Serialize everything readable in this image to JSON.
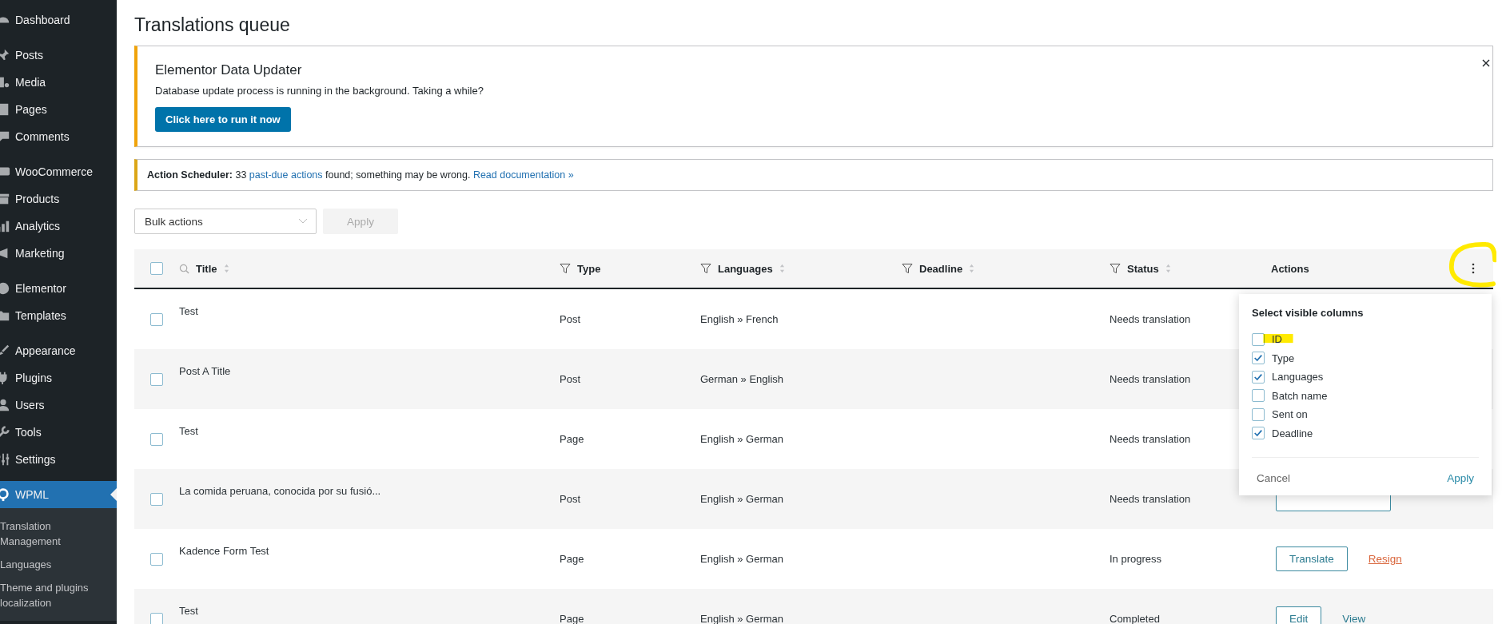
{
  "sidebar": {
    "groups": [
      [
        {
          "label": "Dashboard",
          "selected": false
        }
      ],
      [
        {
          "label": "Posts",
          "selected": false
        },
        {
          "label": "Media",
          "selected": false
        },
        {
          "label": "Pages",
          "selected": false
        },
        {
          "label": "Comments",
          "selected": false
        }
      ],
      [
        {
          "label": "WooCommerce",
          "selected": false
        },
        {
          "label": "Products",
          "selected": false
        },
        {
          "label": "Analytics",
          "selected": false
        },
        {
          "label": "Marketing",
          "selected": false
        }
      ],
      [
        {
          "label": "Elementor",
          "selected": false
        },
        {
          "label": "Templates",
          "selected": false
        }
      ],
      [
        {
          "label": "Appearance",
          "selected": false
        },
        {
          "label": "Plugins",
          "selected": false
        },
        {
          "label": "Users",
          "selected": false
        },
        {
          "label": "Tools",
          "selected": false
        },
        {
          "label": "Settings",
          "selected": false
        }
      ],
      [
        {
          "label": "WPML",
          "selected": true
        }
      ]
    ],
    "submenu": [
      "Translation Management",
      "Languages",
      "Theme and plugins localization"
    ]
  },
  "page_title": "Translations queue",
  "notice": {
    "title": "Elementor Data Updater",
    "message": "Database update process is running in the background. Taking a while?",
    "button": "Click here to run it now"
  },
  "scheduler": {
    "label": "Action Scheduler:",
    "count": "33",
    "link": "past-due actions",
    "text": "found; something may be wrong.",
    "doc_link": "Read documentation »"
  },
  "bulk": {
    "select": "Bulk actions",
    "apply": "Apply",
    "apply_disabled": true
  },
  "table": {
    "select_all_checked": false,
    "columns": [
      {
        "label": "Title",
        "search": true,
        "filter": false,
        "sortable": true
      },
      {
        "label": "Type",
        "search": false,
        "filter": true,
        "sortable": false
      },
      {
        "label": "Languages",
        "search": false,
        "filter": true,
        "sortable": true
      },
      {
        "label": "Deadline",
        "search": false,
        "filter": true,
        "sortable": true
      },
      {
        "label": "Status",
        "search": false,
        "filter": true,
        "sortable": true
      },
      {
        "label": "Actions",
        "search": false,
        "filter": false,
        "sortable": false
      }
    ],
    "rows": [
      {
        "checked": false,
        "title": "Test",
        "type": "Post",
        "languages": "English » French",
        "status": "Needs translation",
        "actions": []
      },
      {
        "checked": false,
        "title": "Post A Title",
        "type": "Post",
        "languages": "German » English",
        "status": "Needs translation",
        "actions": []
      },
      {
        "checked": false,
        "title": "Test",
        "type": "Page",
        "languages": "English » German",
        "status": "Needs translation",
        "actions": []
      },
      {
        "checked": false,
        "title": "La comida peruana, conocida por su fusió...",
        "type": "Post",
        "languages": "English » German",
        "status": "Needs translation",
        "actions": [
          {
            "kind": "covered"
          }
        ]
      },
      {
        "checked": false,
        "title": "Kadence Form Test",
        "type": "Page",
        "languages": "English » German",
        "status": "In progress",
        "actions": [
          {
            "kind": "button",
            "label": "Translate"
          },
          {
            "kind": "danger-link",
            "label": "Resign"
          }
        ]
      },
      {
        "checked": false,
        "title": "Test",
        "type": "Page",
        "languages": "English » German",
        "status": "Completed",
        "actions": [
          {
            "kind": "button",
            "label": "Edit"
          },
          {
            "kind": "link",
            "label": "View"
          }
        ]
      }
    ]
  },
  "column_menu": {
    "title": "Select visible columns",
    "options": [
      {
        "label": "ID",
        "checked": false
      },
      {
        "label": "Type",
        "checked": true
      },
      {
        "label": "Languages",
        "checked": true
      },
      {
        "label": "Batch name",
        "checked": false
      },
      {
        "label": "Sent on",
        "checked": false
      },
      {
        "label": "Deadline",
        "checked": true
      }
    ],
    "cancel": "Cancel",
    "apply": "Apply"
  },
  "highlights": {
    "menu_circle": true,
    "id_mark": true
  }
}
